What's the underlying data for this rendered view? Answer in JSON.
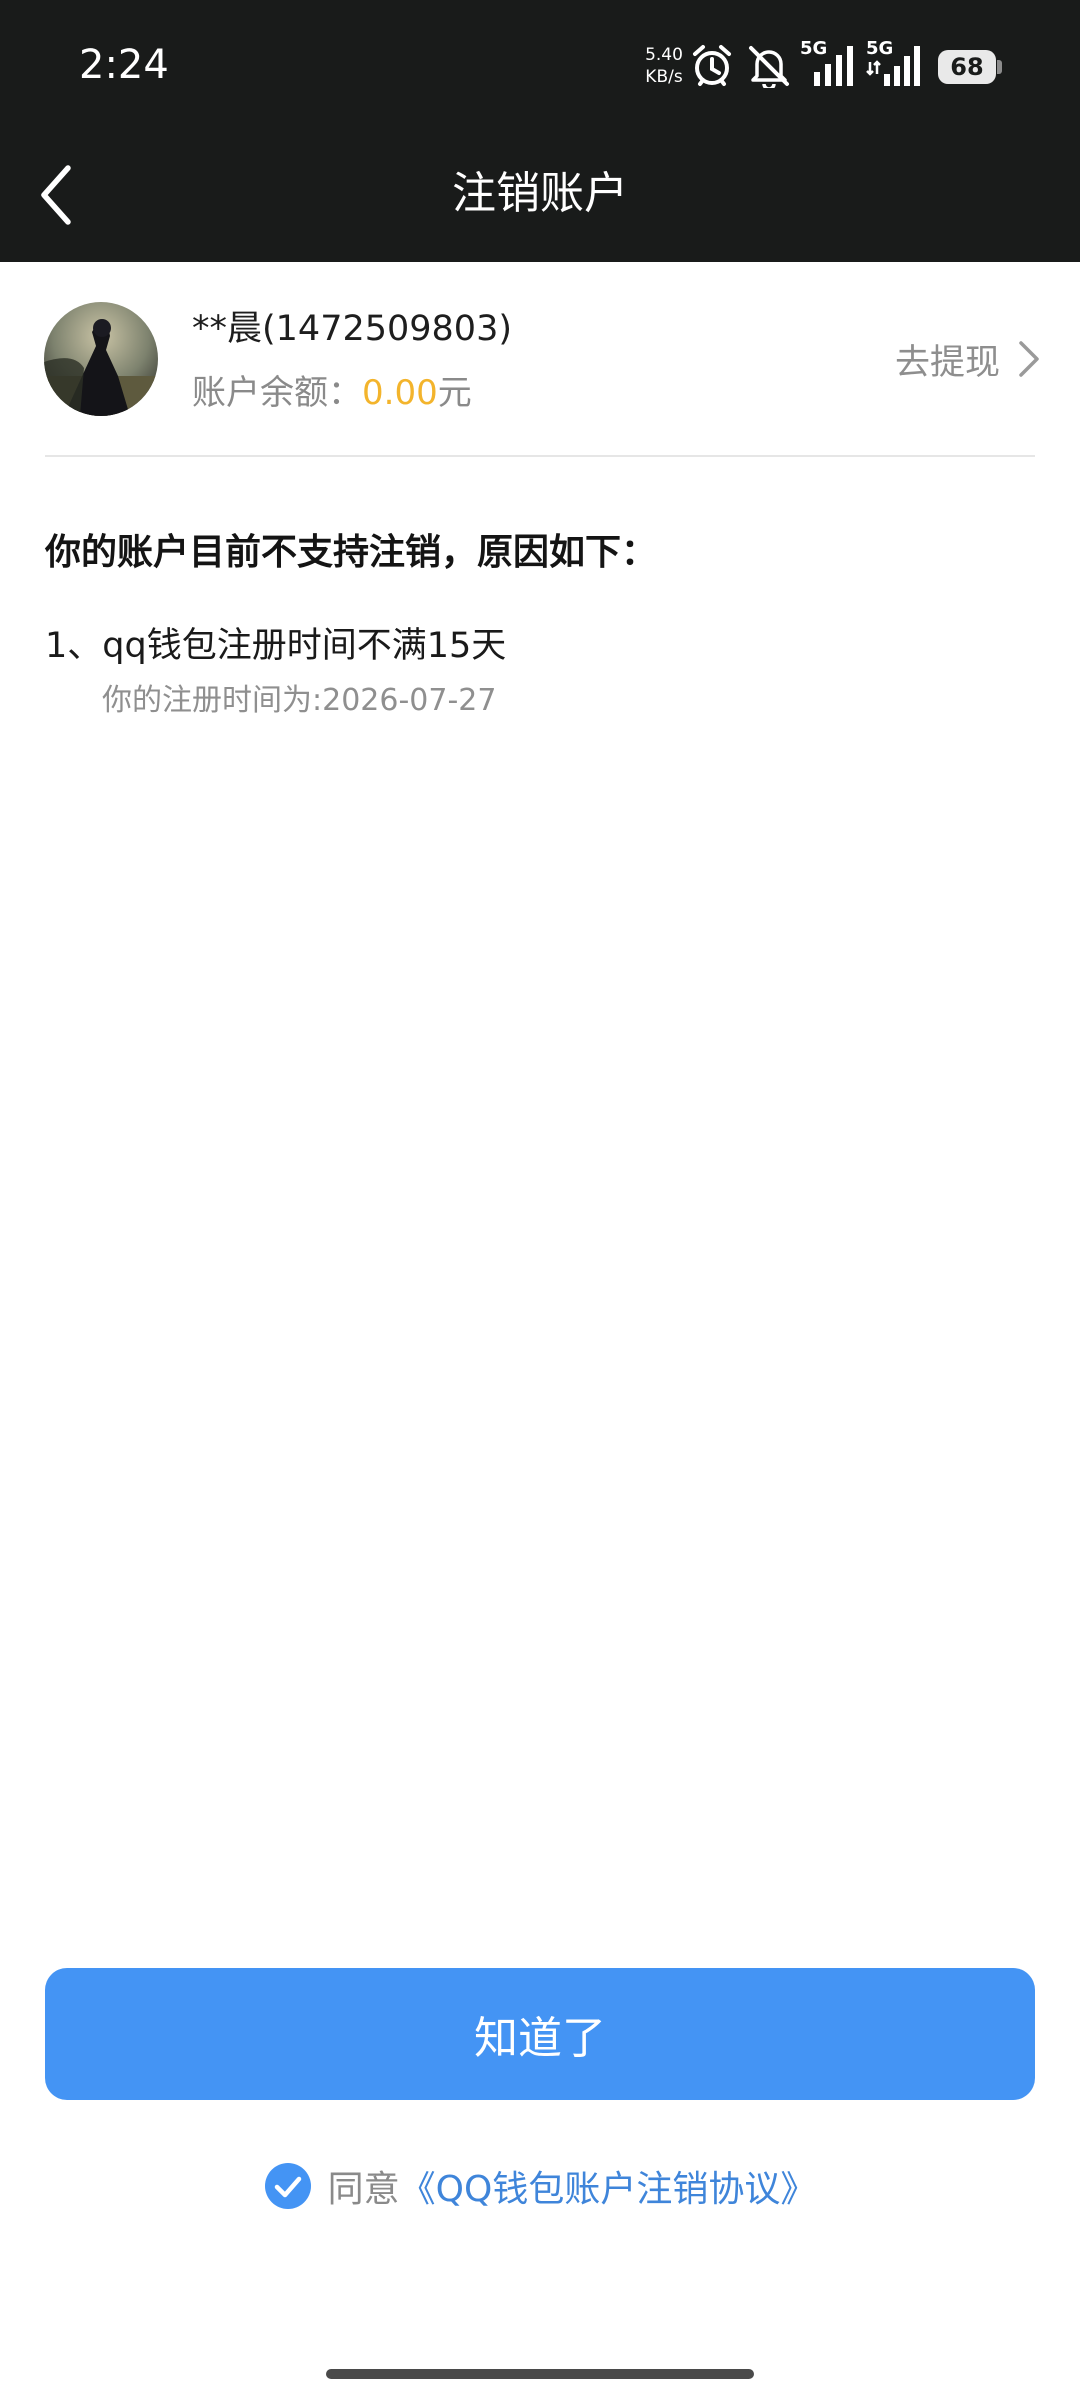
{
  "status_bar": {
    "time": "2:24",
    "net_speed_value": "5.40",
    "net_speed_unit": "KB/s",
    "signal_1_label": "5G",
    "signal_2_label": "5G",
    "battery_level": "68",
    "icons": [
      "alarm-icon",
      "notifications-muted-icon",
      "signal-icon",
      "signal-icon"
    ]
  },
  "header": {
    "title": "注销账户",
    "back_icon": "chevron-left-icon"
  },
  "account": {
    "name": "**晨(1472509803)",
    "balance_label": "账户余额：",
    "balance_amount": "0.00",
    "balance_unit": "元",
    "withdraw_label": "去提现",
    "balance_color": "#f3b42c"
  },
  "notice": {
    "heading": "你的账户目前不支持注销，原因如下：",
    "reasons": [
      {
        "title": "1、qq钱包注册时间不满15天",
        "detail": "你的注册时间为:2026-07-27"
      }
    ]
  },
  "actions": {
    "confirm_label": "知道了",
    "button_color": "#4494f4"
  },
  "agreement": {
    "checked": true,
    "prefix": "同意",
    "link_text": "《QQ钱包账户注销协议》"
  }
}
